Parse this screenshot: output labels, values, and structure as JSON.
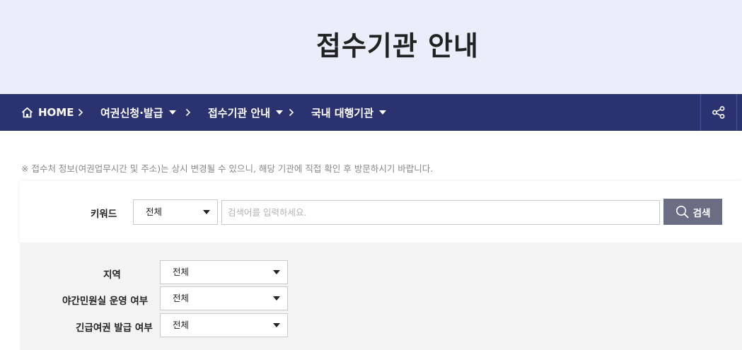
{
  "header": {
    "title": "접수기관 안내"
  },
  "breadcrumb": {
    "home_label": "HOME",
    "items": [
      {
        "label": "여권신청·발급"
      },
      {
        "label": "접수기관 안내"
      },
      {
        "label": "국내 대행기관"
      }
    ]
  },
  "notice": "※ 접수처 정보(여권업무시간 및 주소)는 상시 변경될 수 있으니, 해당 기관에 직접 확인 후 방문하시기 바랍니다.",
  "search": {
    "keyword_label": "키워드",
    "scope_value": "전체",
    "placeholder": "검색어를 입력하세요.",
    "button_label": "검색"
  },
  "filters": [
    {
      "label": "지역",
      "value": "전체"
    },
    {
      "label": "야간민원실 운영 여부",
      "value": "전체"
    },
    {
      "label": "긴급여권 발급 여부",
      "value": "전체"
    }
  ],
  "colors": {
    "hero_bg": "#ebedfb",
    "nav_bg": "#2b3270",
    "search_button": "#696e85",
    "filter_bg": "#f3f3f3"
  }
}
